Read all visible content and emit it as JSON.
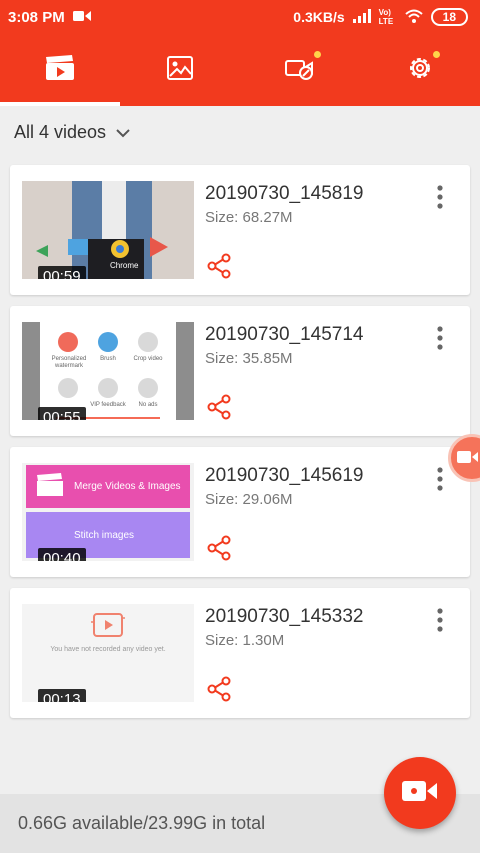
{
  "status": {
    "time": "3:08 PM",
    "network": "0.3KB/s",
    "carrier": "Vo) LTE",
    "battery": "18"
  },
  "tabs": [
    {
      "name": "videos",
      "icon": "video-clapper-icon",
      "active": true
    },
    {
      "name": "images",
      "icon": "image-icon",
      "active": false
    },
    {
      "name": "edit",
      "icon": "video-edit-icon",
      "active": false,
      "badge": true
    },
    {
      "name": "settings",
      "icon": "gear-icon",
      "active": false,
      "badge": true
    }
  ],
  "filter": {
    "label": "All 4 videos"
  },
  "videos": [
    {
      "title": "20190730_145819",
      "size": "Size: 68.27M",
      "duration": "00:59",
      "thumb_text": "Chrome"
    },
    {
      "title": "20190730_145714",
      "size": "Size: 35.85M",
      "duration": "00:55",
      "thumb_labels": [
        "Personalized watermark",
        "Brush",
        "Crop video",
        "VIP feedback",
        "No ads"
      ]
    },
    {
      "title": "20190730_145619",
      "size": "Size: 29.06M",
      "duration": "00:40",
      "thumb_labels": [
        "Merge Videos & Images",
        "Stitch images"
      ]
    },
    {
      "title": "20190730_145332",
      "size": "Size: 1.30M",
      "duration": "00:13",
      "thumb_text": "You have not recorded any video yet."
    }
  ],
  "storage": "0.66G available/23.99G in total",
  "colors": {
    "brand": "#f23a1e",
    "accent_dot": "#ffd54a"
  }
}
